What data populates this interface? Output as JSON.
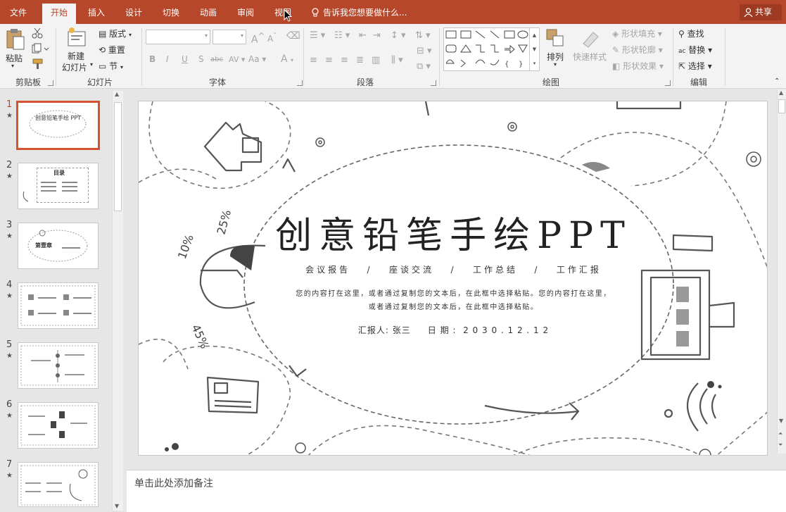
{
  "ribbon_tabs": [
    "文件",
    "开始",
    "插入",
    "设计",
    "切换",
    "动画",
    "审阅",
    "视图"
  ],
  "active_tab": "开始",
  "tell_me": "告诉我您想要做什么...",
  "share": "共享",
  "clipboard": {
    "paste": "粘贴",
    "label": "剪贴板"
  },
  "slides_group": {
    "new_slide_line1": "新建",
    "new_slide_line2": "幻灯片",
    "layout": "版式",
    "reset": "重置",
    "section": "节",
    "label": "幻灯片"
  },
  "font_group": {
    "bold": "B",
    "italic": "I",
    "underline": "U",
    "shadow": "S",
    "strike": "abc",
    "spacing": "AV",
    "case": "Aa",
    "color": "A",
    "grow": "A",
    "shrink": "A",
    "label": "字体"
  },
  "paragraph_group": {
    "label": "段落"
  },
  "drawing_group": {
    "arrange": "排列",
    "quick_styles": "快速样式",
    "shape_fill": "形状填充",
    "shape_outline": "形状轮廓",
    "shape_effects": "形状效果",
    "label": "绘图"
  },
  "editing_group": {
    "find": "查找",
    "replace": "替换",
    "select": "选择",
    "label": "编辑"
  },
  "thumbnails": [
    {
      "num": "1",
      "title": "创意铅笔手绘 PPT"
    },
    {
      "num": "2",
      "title": "目录"
    },
    {
      "num": "3",
      "title": "第壹章"
    },
    {
      "num": "4",
      "title": ""
    },
    {
      "num": "5",
      "title": ""
    },
    {
      "num": "6",
      "title": ""
    },
    {
      "num": "7",
      "title": ""
    }
  ],
  "slide": {
    "title": "创意铅笔手绘PPT",
    "subtitle": "会议报告   /   座谈交流   /   工作总结   /   工作汇报",
    "body_line1": "您的内容打在这里，或者通过复制您的文本后，在此框中选择粘贴。您的内容打在这里，",
    "body_line2": "或者通过复制您的文本后，在此框中选择粘贴。",
    "reporter": "汇报人: 张三     日 期 :  2 0 3 0 . 1 2 . 1 2",
    "label_10": "10%",
    "label_25": "25%",
    "label_45": "45%"
  },
  "notes_placeholder": "单击此处添加备注",
  "colors": {
    "accent": "#b7472a",
    "selection": "#d35230",
    "ribbon_bg": "#f3f3f3"
  }
}
